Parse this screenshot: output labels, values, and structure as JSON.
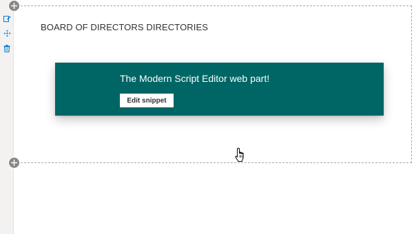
{
  "section": {
    "title": "BOARD OF DIRECTORS DIRECTORIES"
  },
  "webpart": {
    "message": "The Modern Script Editor web part!",
    "edit_button_label": "Edit snippet",
    "background_color": "#006565"
  },
  "toolbar": {
    "icons": [
      "edit-icon",
      "move-icon",
      "delete-icon"
    ],
    "accent_color": "#0078d4"
  },
  "controls": {
    "add_section_icon": "plus-icon"
  }
}
